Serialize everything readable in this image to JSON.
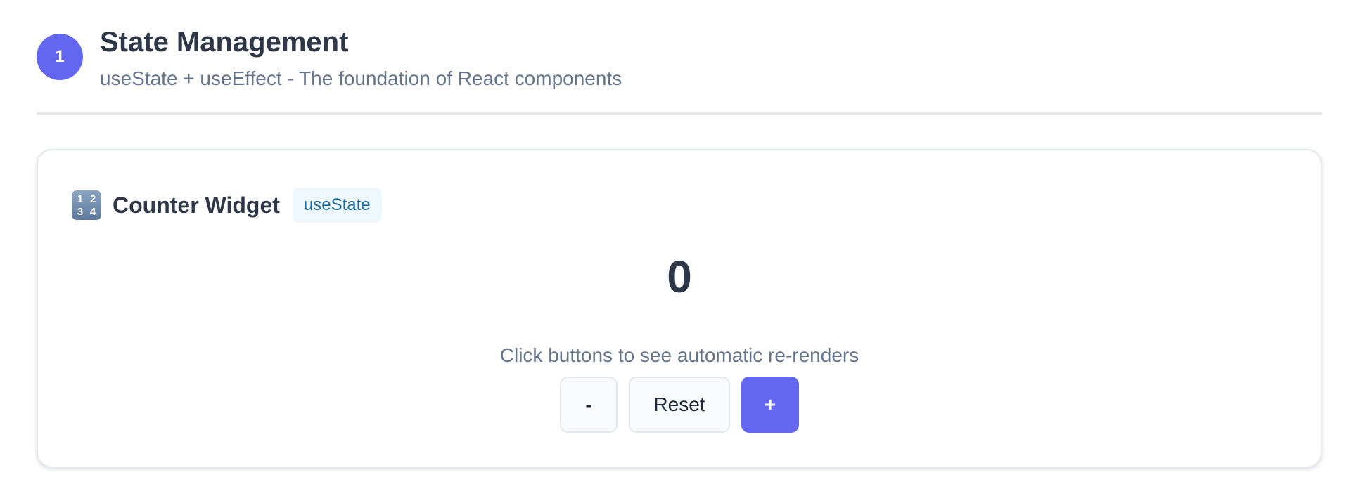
{
  "section": {
    "step_number": "1",
    "title": "State Management",
    "subtitle": "useState + useEffect - The foundation of React components"
  },
  "widget": {
    "icon": "input-numbers-icon",
    "icon_digits": [
      "1",
      "2",
      "3",
      "4"
    ],
    "title": "Counter Widget",
    "hook_badge": "useState",
    "count": "0",
    "hint": "Click buttons to see automatic re-renders",
    "buttons": {
      "decrement": "-",
      "reset": "Reset",
      "increment": "+"
    }
  },
  "colors": {
    "accent": "#6366f1",
    "badge_text": "#1d6fa3",
    "badge_background": "#eff8ff",
    "title_text": "#2d3748",
    "muted_text": "#64748b"
  }
}
